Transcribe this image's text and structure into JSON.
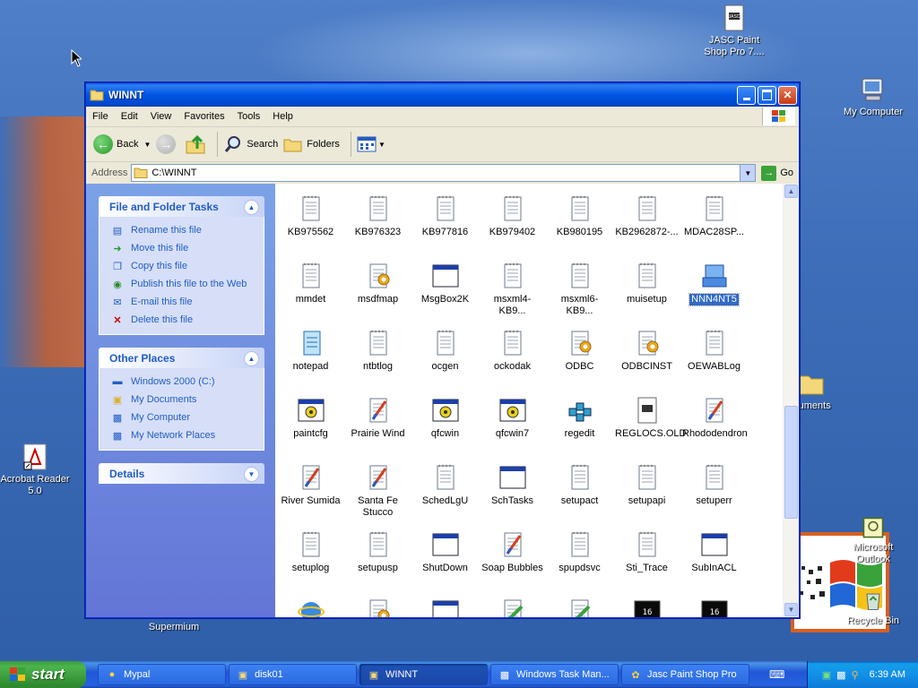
{
  "desktop": {
    "icons": [
      {
        "label": "JASC Paint Shop Pro 7...."
      },
      {
        "label": "My Computer"
      },
      {
        "label": "Acrobat Reader 5.0"
      },
      {
        "label": "Supermium"
      },
      {
        "label": "ocuments"
      },
      {
        "label": "Microsoft Outlook"
      },
      {
        "label": "Recycle Bin"
      }
    ]
  },
  "window": {
    "title": "WINNT",
    "menu": [
      "File",
      "Edit",
      "View",
      "Favorites",
      "Tools",
      "Help"
    ],
    "toolbar": {
      "back": "Back",
      "search": "Search",
      "folders": "Folders"
    },
    "address": {
      "label": "Address",
      "value": "C:\\WINNT",
      "go": "Go"
    }
  },
  "tasks": {
    "file_folder": {
      "title": "File and Folder Tasks",
      "items": [
        "Rename this file",
        "Move this file",
        "Copy this file",
        "Publish this file to the Web",
        "E-mail this file",
        "Delete this file"
      ]
    },
    "other_places": {
      "title": "Other Places",
      "items": [
        "Windows 2000 (C:)",
        "My Documents",
        "My Computer",
        "My Network Places"
      ]
    },
    "details": {
      "title": "Details"
    }
  },
  "files": [
    {
      "name": "KB975562",
      "icon": "text-file-icon"
    },
    {
      "name": "KB976323",
      "icon": "text-file-icon"
    },
    {
      "name": "KB977816",
      "icon": "text-file-icon"
    },
    {
      "name": "KB979402",
      "icon": "text-file-icon"
    },
    {
      "name": "KB980195",
      "icon": "text-file-icon"
    },
    {
      "name": "KB2962872-...",
      "icon": "text-file-icon"
    },
    {
      "name": "MDAC28SP...",
      "icon": "text-file-icon"
    },
    {
      "name": "mmdet",
      "icon": "text-file-icon"
    },
    {
      "name": "msdfmap",
      "icon": "config-file-icon"
    },
    {
      "name": "MsgBox2K",
      "icon": "app-window-icon"
    },
    {
      "name": "msxml4-KB9...",
      "icon": "text-file-icon"
    },
    {
      "name": "msxml6-KB9...",
      "icon": "text-file-icon"
    },
    {
      "name": "muisetup",
      "icon": "text-file-icon"
    },
    {
      "name": "NNN4NT5",
      "icon": "installer-icon",
      "selected": true
    },
    {
      "name": "notepad",
      "icon": "notepad-icon"
    },
    {
      "name": "ntbtlog",
      "icon": "text-file-icon"
    },
    {
      "name": "ocgen",
      "icon": "text-file-icon"
    },
    {
      "name": "ockodak",
      "icon": "text-file-icon"
    },
    {
      "name": "ODBC",
      "icon": "config-file-icon"
    },
    {
      "name": "ODBCINST",
      "icon": "config-file-icon"
    },
    {
      "name": "OEWABLog",
      "icon": "text-file-icon"
    },
    {
      "name": "paintcfg",
      "icon": "app-gear-icon"
    },
    {
      "name": "Prairie Wind",
      "icon": "bitmap-icon"
    },
    {
      "name": "qfcwin",
      "icon": "app-gear-icon"
    },
    {
      "name": "qfcwin7",
      "icon": "app-gear-icon"
    },
    {
      "name": "regedit",
      "icon": "regedit-icon"
    },
    {
      "name": "REGLOCS.OLD",
      "icon": "psp-file-icon"
    },
    {
      "name": "Rhododendron",
      "icon": "bitmap-icon"
    },
    {
      "name": "River Sumida",
      "icon": "bitmap-icon"
    },
    {
      "name": "Santa Fe Stucco",
      "icon": "bitmap-icon"
    },
    {
      "name": "SchedLgU",
      "icon": "text-file-icon"
    },
    {
      "name": "SchTasks",
      "icon": "app-window-icon"
    },
    {
      "name": "setupact",
      "icon": "text-file-icon"
    },
    {
      "name": "setupapi",
      "icon": "text-file-icon"
    },
    {
      "name": "setuperr",
      "icon": "text-file-icon"
    },
    {
      "name": "setuplog",
      "icon": "text-file-icon"
    },
    {
      "name": "setupusp",
      "icon": "text-file-icon"
    },
    {
      "name": "ShutDown",
      "icon": "app-window-icon"
    },
    {
      "name": "Soap Bubbles",
      "icon": "bitmap-icon"
    },
    {
      "name": "spupdsvc",
      "icon": "text-file-icon"
    },
    {
      "name": "Sti_Trace",
      "icon": "text-file-icon"
    },
    {
      "name": "SubInACL",
      "icon": "app-window-icon"
    },
    {
      "name": "",
      "icon": "ie-icon"
    },
    {
      "name": "",
      "icon": "config-file-icon"
    },
    {
      "name": "",
      "icon": "app-window-icon"
    },
    {
      "name": "",
      "icon": "setup-icon"
    },
    {
      "name": "",
      "icon": "setup-icon"
    },
    {
      "name": "",
      "icon": "dos-app-icon"
    },
    {
      "name": "",
      "icon": "dos-app-icon"
    }
  ],
  "taskbar": {
    "start": "start",
    "tasks": [
      {
        "label": "Mypal",
        "icon": "mypal-icon"
      },
      {
        "label": "disk01",
        "icon": "folder-icon"
      },
      {
        "label": "WINNT",
        "icon": "folder-icon",
        "active": true
      },
      {
        "label": "Windows Task Man...",
        "icon": "taskmgr-icon"
      },
      {
        "label": "Jasc Paint Shop Pro",
        "icon": "psp-icon"
      }
    ],
    "clock": "6:39 AM"
  },
  "colors": {
    "titlebar": "#0054e3",
    "taskbar": "#245edb",
    "start": "#3c9a3c",
    "link": "#215dc6",
    "selection": "#316ac5"
  }
}
